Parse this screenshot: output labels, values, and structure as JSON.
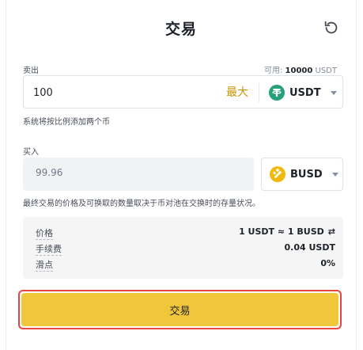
{
  "header": {
    "title": "交易"
  },
  "sell": {
    "label": "卖出",
    "available_label": "可用:",
    "available_amount": "10000",
    "available_unit": "USDT",
    "amount": "100",
    "max_label": "最大",
    "coin": "USDT"
  },
  "note_add": "系统将按比例添加两个币",
  "buy": {
    "label": "买入",
    "amount": "99.96",
    "coin": "BUSD"
  },
  "note_final": "最终交易的价格及可换取的数量取决于币对池在交换时的存量状况。",
  "details": {
    "price_label": "价格",
    "price_value": "1 USDT ≈ 1 BUSD",
    "fee_label": "手续费",
    "fee_value": "0.04 USDT",
    "slippage_label": "滑点",
    "slippage_value": "0%"
  },
  "trade_button": "交易",
  "colors": {
    "accent": "#f0c63b",
    "highlight_border": "#e8473f",
    "usdt": "#26a17b",
    "busd": "#f0b90b",
    "max_text": "#c99400"
  },
  "icons": {
    "refresh": "refresh-icon",
    "usdt": "usdt-coin-icon",
    "busd": "busd-coin-icon",
    "swap": "swap-arrows-icon"
  }
}
